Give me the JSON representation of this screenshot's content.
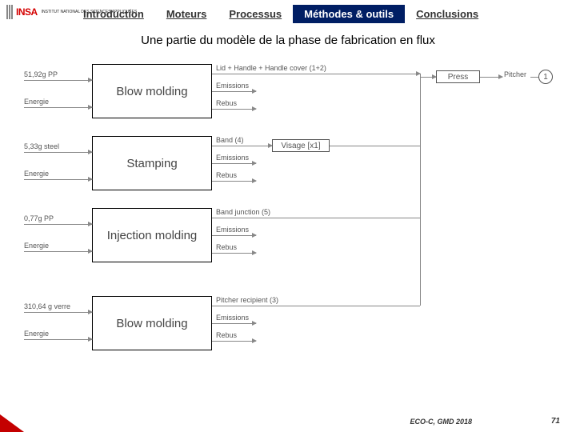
{
  "logo": {
    "name": "INSA",
    "sub": "INSTITUT\nNATIONAL\nDES SCIENCES\nAPPLIQUÉES"
  },
  "nav": {
    "items": [
      {
        "label": "Introduction"
      },
      {
        "label": "Moteurs"
      },
      {
        "label": "Processus"
      },
      {
        "label": "Méthodes & outils",
        "active": true
      },
      {
        "label": "Conclusions"
      }
    ]
  },
  "subtitle": "Une partie du modèle de la phase de fabrication en flux",
  "processes": {
    "p1": {
      "title": "Blow molding",
      "in1": "51,92g PP",
      "in2": "Energie",
      "out1": "Lid + Handle + Handle cover (1+2)",
      "out2": "Emissions",
      "out3": "Rebus"
    },
    "p2": {
      "title": "Stamping",
      "in1": "5,33g steel",
      "in2": "Energie",
      "out1": "Band (4)",
      "out2": "Emissions",
      "out3": "Rebus"
    },
    "p3": {
      "title": "Injection molding",
      "in1": "0,77g PP",
      "in2": "Energie",
      "out1": "Band junction (5)",
      "out2": "Emissions",
      "out3": "Rebus"
    },
    "p4": {
      "title": "Blow molding",
      "in1": "310,64 g verre",
      "in2": "Energie",
      "out1": "Pitcher recipient (3)",
      "out2": "Emissions",
      "out3": "Rebus"
    }
  },
  "boxes": {
    "visage": "Visage  [x1]",
    "press": "Press",
    "pitcher": "Pitcher",
    "one": "1"
  },
  "footer": {
    "conf": "ECO-C, GMD 2018",
    "page": "71"
  }
}
